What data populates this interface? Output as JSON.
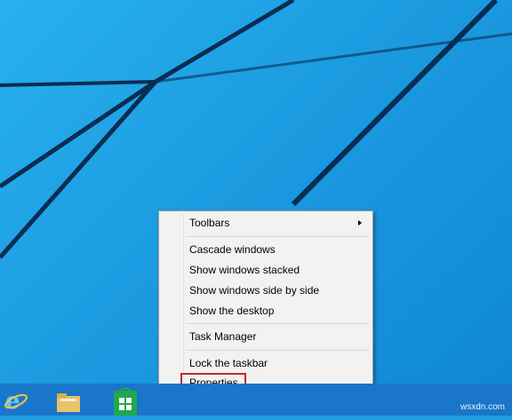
{
  "menu": {
    "items": [
      {
        "label": "Toolbars",
        "submenu": true
      },
      {
        "label": "Cascade windows"
      },
      {
        "label": "Show windows stacked"
      },
      {
        "label": "Show windows side by side"
      },
      {
        "label": "Show the desktop"
      },
      {
        "label": "Task Manager"
      },
      {
        "label": "Lock the taskbar"
      },
      {
        "label": "Properties",
        "highlighted": true
      }
    ],
    "highlight_color": "#c62828"
  },
  "taskbar": {
    "icons": [
      "internet-explorer-icon",
      "file-explorer-icon",
      "store-icon"
    ],
    "color": "#1976c8"
  },
  "watermark": "wsxdn.com"
}
